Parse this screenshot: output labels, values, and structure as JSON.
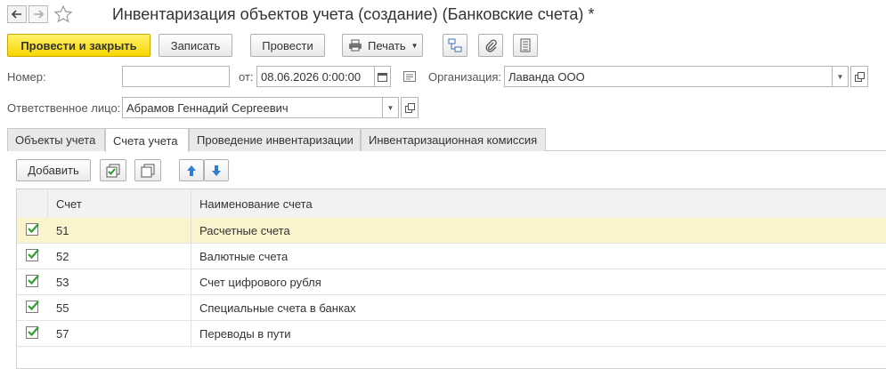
{
  "window": {
    "title": "Инвентаризация объектов учета  (создание) (Банковские счета) *"
  },
  "toolbar": {
    "post_close": "Провести и закрыть",
    "save": "Записать",
    "post": "Провести",
    "print": "Печать"
  },
  "form": {
    "number_label": "Номер:",
    "number_value": "",
    "date_label": "от:",
    "date_value": "08.06.2026  0:00:00",
    "org_label": "Организация:",
    "org_value": "Лаванда ООО",
    "resp_label": "Ответственное лицо:",
    "resp_value": "Абрамов Геннадий Сергеевич"
  },
  "tabs": [
    {
      "label": "Объекты учета"
    },
    {
      "label": "Счета учета"
    },
    {
      "label": "Проведение инвентаризации"
    },
    {
      "label": "Инвентаризационная комиссия"
    }
  ],
  "table_toolbar": {
    "add": "Добавить"
  },
  "table": {
    "headers": [
      "Счет",
      "Наименование счета"
    ],
    "rows": [
      {
        "checked": true,
        "account": "51",
        "name": "Расчетные счета"
      },
      {
        "checked": true,
        "account": "52",
        "name": "Валютные счета"
      },
      {
        "checked": true,
        "account": "53",
        "name": "Счет цифрового рубля"
      },
      {
        "checked": true,
        "account": "55",
        "name": "Специальные счета в банках"
      },
      {
        "checked": true,
        "account": "57",
        "name": "Переводы в пути"
      }
    ]
  },
  "colors": {
    "primary_button": "#f6d600",
    "selected_row": "#fbf3cc",
    "check_green": "#2f9e2f",
    "arrow_blue": "#2f7fd0"
  }
}
